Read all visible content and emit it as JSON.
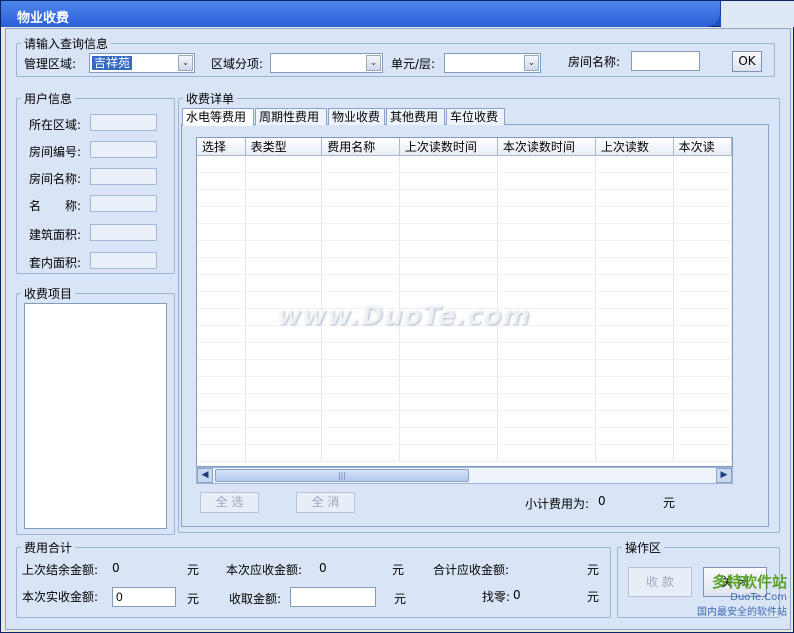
{
  "window": {
    "title": "物业收费"
  },
  "query": {
    "legend": "请输入查询信息",
    "area_label": "管理区域:",
    "area_value": "吉祥苑",
    "subarea_label": "区域分项:",
    "subarea_value": "",
    "unit_label": "单元/层:",
    "unit_value": "",
    "room_name_label": "房间名称:",
    "room_name_value": "",
    "ok_label": "OK"
  },
  "user_info": {
    "legend": "用户信息",
    "fields": [
      {
        "label": "所在区域:",
        "value": ""
      },
      {
        "label": "房间编号:",
        "value": ""
      },
      {
        "label": "房间名称:",
        "value": ""
      },
      {
        "label": "名　　称:",
        "value": ""
      },
      {
        "label": "建筑面积:",
        "value": ""
      },
      {
        "label": "套内面积:",
        "value": ""
      }
    ]
  },
  "fee_items": {
    "legend": "收费项目"
  },
  "detail": {
    "legend": "收费详单",
    "tabs": [
      "水电等费用",
      "周期性费用",
      "物业收费",
      "其他费用",
      "车位收费"
    ],
    "active_tab": 0,
    "columns": [
      "选择",
      "表类型",
      "费用名称",
      "上次读数时间",
      "本次读数时间",
      "上次读数",
      "本次读"
    ],
    "select_all_label": "全 选",
    "clear_all_label": "全 消",
    "subtotal_label": "小计费用为:",
    "subtotal_value": "0",
    "subtotal_unit": "元"
  },
  "totals": {
    "legend": "费用合计",
    "last_balance_label": "上次结余金额:",
    "last_balance_value": "0",
    "due_label": "本次应收金额:",
    "due_value": "0",
    "total_due_label": "合计应收金额:",
    "total_due_value": "",
    "paid_label": "本次实收金额:",
    "paid_value": "0",
    "received_label": "收取金额:",
    "received_value": "",
    "change_label": "找零:",
    "change_value": "0",
    "unit": "元"
  },
  "ops": {
    "legend": "操作区",
    "collect_label": "收 款",
    "close_label": "关 闭"
  },
  "watermark": {
    "center": "www.DuoTe.com",
    "corner_top": "多特软件站",
    "corner_sub": "DuoTe.Com",
    "corner_bottom": "国内最安全的软件站"
  }
}
